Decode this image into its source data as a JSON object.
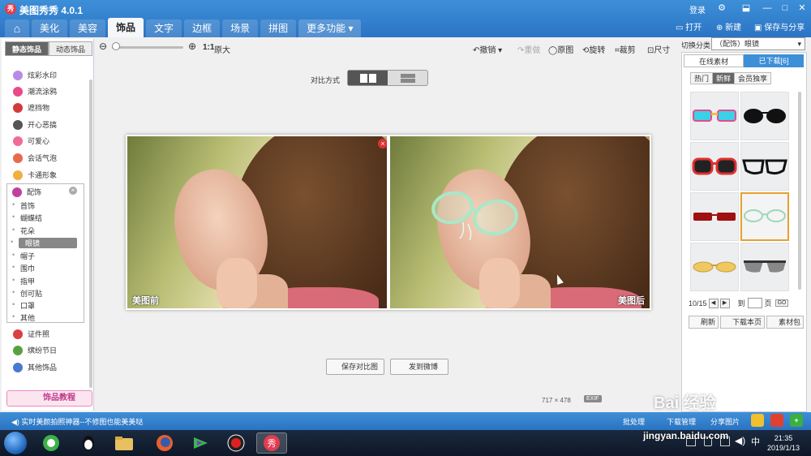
{
  "window": {
    "logo_text": "秀",
    "title": "美图秀秀 4.0.1",
    "login": "登录",
    "controls": {
      "settings": "⚙",
      "minimize": "—",
      "maximize": "□",
      "close": "✕"
    }
  },
  "tabs": [
    {
      "label": "⌂"
    },
    {
      "label": "美化"
    },
    {
      "label": "美容"
    },
    {
      "label": "饰品"
    },
    {
      "label": "文字"
    },
    {
      "label": "边框"
    },
    {
      "label": "场景"
    },
    {
      "label": "拼图"
    },
    {
      "label": "更多功能 ▾"
    }
  ],
  "top_actions": {
    "open": "打开",
    "new": "新建",
    "save_share": "保存与分享"
  },
  "toolbar": {
    "ratio": "1:1",
    "original_size": "原大",
    "undo": "撤销",
    "redo": "重做",
    "original": "原图",
    "rotate": "旋转",
    "crop": "裁剪",
    "resize": "尺寸"
  },
  "sidebar": {
    "tabs": [
      "静态饰品",
      "动态饰品"
    ],
    "items": [
      {
        "label": "炫彩水印",
        "color": "#b88ae6"
      },
      {
        "label": "潮流涂鸦",
        "color": "#e84a8a"
      },
      {
        "label": "遮挡物",
        "color": "#d33b3b"
      },
      {
        "label": "开心恶搞",
        "color": "#555555"
      },
      {
        "label": "可爱心",
        "color": "#f06a9a"
      },
      {
        "label": "会话气泡",
        "color": "#e86a4a"
      },
      {
        "label": "卡通形象",
        "color": "#f0b040"
      }
    ],
    "sub_panel": {
      "title": "配饰",
      "items": [
        "首饰",
        "蝴蝶结",
        "花朵",
        "眼镜",
        "帽子",
        "围巾",
        "指甲",
        "创可贴",
        "口罩",
        "其他"
      ],
      "selected": "眼镜"
    },
    "lower_items": [
      {
        "label": "证件照",
        "color": "#d94040"
      },
      {
        "label": "缤纷节日",
        "color": "#5aa040"
      },
      {
        "label": "其他饰品",
        "color": "#4a7ad0"
      }
    ],
    "tutorial": "饰品教程"
  },
  "canvas": {
    "compare_label": "对比方式",
    "before_label": "美图前",
    "after_label": "美图后",
    "save_compare": "保存对比图",
    "post_weibo": "发到微博",
    "dimensions": "717 × 478",
    "exif": "EXIF"
  },
  "right_panel": {
    "category_label": "切换分类",
    "category_value": "（配饰）眼镜",
    "tabs": [
      "在线素材",
      "已下载[6]"
    ],
    "filter_tabs": [
      "热门",
      "新鲜",
      "会员独享"
    ],
    "active_filter": "新鲜",
    "page_current": "10/15",
    "page_to": "到",
    "page_unit": "页",
    "go": "GO",
    "actions": [
      "刷新",
      "下载本页",
      "素材包"
    ]
  },
  "status": {
    "tip": "实时美颜拍照神器--不修图也能美美哒",
    "batch": "批处理",
    "download_mgr": "下载管理",
    "share_img": "分享图片"
  },
  "taskbar": {
    "time": "21:35",
    "date": "2019/1/13"
  },
  "watermark": {
    "brand": "Bai 经验",
    "url": "jingyan.baidu.com"
  }
}
